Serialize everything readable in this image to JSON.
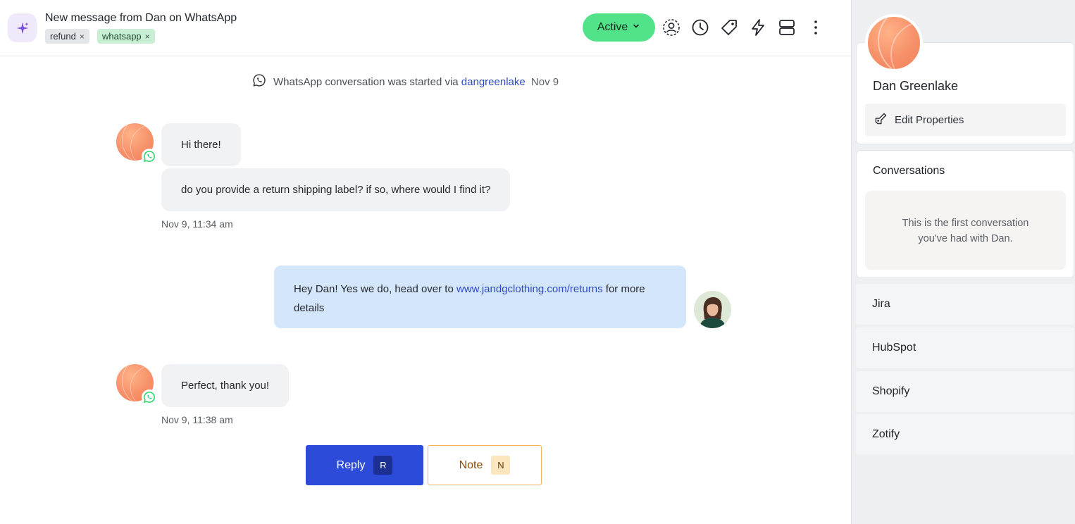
{
  "header": {
    "title": "New message from Dan on WhatsApp",
    "tags": [
      {
        "label": "refund",
        "remove": "×"
      },
      {
        "label": "whatsapp",
        "remove": "×"
      }
    ],
    "status": "Active",
    "icons": [
      "assign-user-icon",
      "snooze-clock-icon",
      "tag-icon",
      "macro-lightning-icon",
      "layout-icon",
      "more-vertical-icon"
    ]
  },
  "timeline": {
    "system": {
      "text": "WhatsApp conversation was started via",
      "link": "dangreenlake",
      "date": "Nov 9"
    },
    "messages": [
      {
        "text": "Hi there!"
      },
      {
        "text": "do you provide a return shipping label? if so, where would I find it?"
      },
      {
        "timestamp": "Nov 9, 11:34 am"
      },
      {
        "text_before": "Hey Dan! Yes we do, head over to",
        "link": "www.jandgclothing.com/returns",
        "text_after": "for more details"
      },
      {
        "text": "Perfect, thank you!"
      },
      {
        "timestamp": "Nov 9, 11:38 am"
      }
    ]
  },
  "composer": {
    "reply_label": "Reply",
    "reply_key": "R",
    "note_label": "Note",
    "note_key": "N"
  },
  "sidebar": {
    "profile": {
      "name": "Dan Greenlake",
      "edit_label": "Edit Properties"
    },
    "conversations": {
      "title": "Conversations",
      "empty_text": "This is the first conversation you've had with Dan."
    },
    "apps": [
      "Jira",
      "HubSpot",
      "Shopify",
      "Zotify"
    ]
  },
  "colors": {
    "brand_blue": "#2b4bd8",
    "active_green": "#52e38a",
    "whatsapp_green": "#25d366",
    "note_orange": "#f0b55d"
  }
}
